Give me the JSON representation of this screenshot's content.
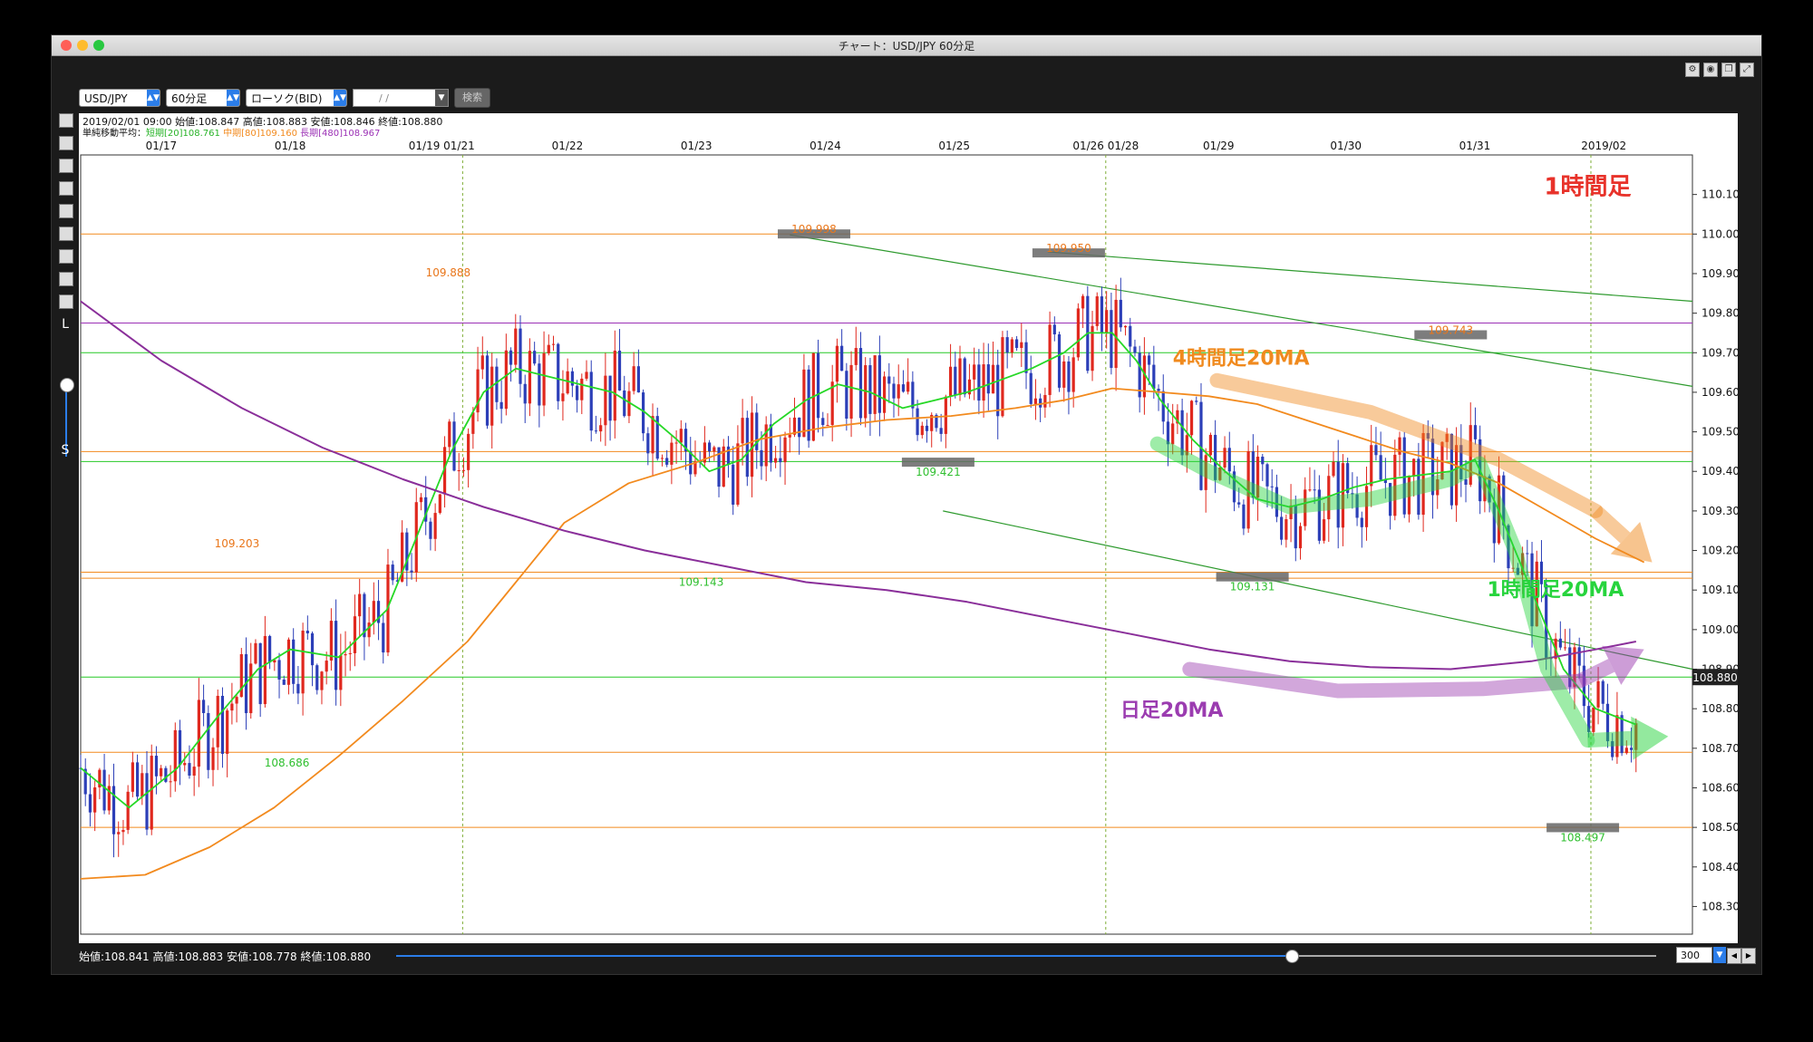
{
  "window": {
    "title": "チャート：USD/JPY 60分足"
  },
  "controls": {
    "pair": "USD/JPY",
    "timeframe": "60分足",
    "chart_type": "ローソク(BID)",
    "date_placeholder": "/ /",
    "search_label": "検索"
  },
  "toolbar_icons": [
    "gear-icon",
    "camera-icon",
    "window-icon",
    "expand-icon"
  ],
  "left_tools": {
    "letter_l": "L",
    "letter_s": "S"
  },
  "info": {
    "line1": "2019/02/01 09:00 始値:108.847 高値:108.883 安値:108.846 終値:108.880",
    "ma_label": "単純移動平均：",
    "ma_short": "短期[20]108.761",
    "ma_mid": "中期[80]109.160",
    "ma_long": "長期[480]108.967"
  },
  "status": {
    "text": "始値:108.841 高値:108.883 安値:108.778 終値:108.880",
    "count": "300",
    "count_fraction": 0.71
  },
  "colors": {
    "candle_up": "#e0281e",
    "candle_down": "#2c3fb8",
    "ma20": "#26d826",
    "ma80": "#f28a1e",
    "ma480": "#8a2f9a",
    "label_red": "#e8322a",
    "label_orange": "#f08a1e",
    "label_purple": "#9b3cb0",
    "label_green": "#27d43d"
  },
  "chart_data": {
    "type": "candlestick",
    "symbol": "USD/JPY",
    "ylim": [
      108.23,
      110.2
    ],
    "y_ticks": [
      "110.100",
      "110.000",
      "109.900",
      "109.800",
      "109.700",
      "109.600",
      "109.500",
      "109.400",
      "109.300",
      "109.200",
      "109.100",
      "109.000",
      "108.900",
      "108.800",
      "108.700",
      "108.600",
      "108.500",
      "108.400",
      "108.300"
    ],
    "x_labels": [
      {
        "t": 0.05,
        "text": "01/17"
      },
      {
        "t": 0.13,
        "text": "01/18"
      },
      {
        "t": 0.224,
        "text": "01/19 01/21"
      },
      {
        "t": 0.302,
        "text": "01/22"
      },
      {
        "t": 0.382,
        "text": "01/23"
      },
      {
        "t": 0.462,
        "text": "01/24"
      },
      {
        "t": 0.542,
        "text": "01/25"
      },
      {
        "t": 0.636,
        "text": "01/26 01/28"
      },
      {
        "t": 0.706,
        "text": "01/29"
      },
      {
        "t": 0.785,
        "text": "01/30"
      },
      {
        "t": 0.865,
        "text": "01/31"
      },
      {
        "t": 0.945,
        "text": "2019/02"
      }
    ],
    "week_markers": [
      0.237,
      0.636,
      0.937
    ],
    "last_price": "108.880",
    "hlines": [
      {
        "y": 110.0,
        "color": "orange"
      },
      {
        "y": 109.775,
        "color": "purple"
      },
      {
        "y": 109.7,
        "color": "green"
      },
      {
        "y": 109.45,
        "color": "orange"
      },
      {
        "y": 109.425,
        "color": "green"
      },
      {
        "y": 109.145,
        "color": "orange"
      },
      {
        "y": 109.13,
        "color": "orange"
      },
      {
        "y": 108.88,
        "color": "green"
      },
      {
        "y": 108.69,
        "color": "orange"
      },
      {
        "y": 108.5,
        "color": "orange"
      }
    ],
    "price_labels": [
      {
        "t": 0.455,
        "y": 109.998,
        "text": "109.998",
        "color": "orange",
        "pos": "above",
        "box": true
      },
      {
        "t": 0.613,
        "y": 109.95,
        "text": "109.950",
        "color": "orange",
        "pos": "above",
        "box": true
      },
      {
        "t": 0.228,
        "y": 109.888,
        "text": "109.888",
        "color": "orange",
        "pos": "above",
        "box": false
      },
      {
        "t": 0.85,
        "y": 109.743,
        "text": "109.743",
        "color": "orange",
        "pos": "above",
        "box": true
      },
      {
        "t": 0.097,
        "y": 109.203,
        "text": "109.203",
        "color": "orange",
        "pos": "above",
        "box": false
      },
      {
        "t": 0.532,
        "y": 109.421,
        "text": "109.421",
        "color": "green",
        "pos": "below",
        "box": true
      },
      {
        "t": 0.385,
        "y": 109.143,
        "text": "109.143",
        "color": "green",
        "pos": "below",
        "box": false
      },
      {
        "t": 0.727,
        "y": 109.131,
        "text": "109.131",
        "color": "green",
        "pos": "below",
        "box": true
      },
      {
        "t": 0.128,
        "y": 108.686,
        "text": "108.686",
        "color": "green",
        "pos": "below",
        "box": false
      },
      {
        "t": 0.932,
        "y": 108.497,
        "text": "108.497",
        "color": "green",
        "pos": "below",
        "box": true
      }
    ],
    "trendlines": [
      {
        "t1": 0.44,
        "y1": 109.998,
        "t2": 1.0,
        "y2": 109.615
      },
      {
        "t1": 0.6,
        "y1": 109.955,
        "t2": 1.0,
        "y2": 109.83
      },
      {
        "t1": 0.535,
        "y1": 109.3,
        "t2": 1.0,
        "y2": 108.9
      }
    ],
    "series": [
      {
        "name": "短期[20]",
        "color": "ma20",
        "points": [
          [
            0.0,
            108.65
          ],
          [
            0.03,
            108.55
          ],
          [
            0.06,
            108.65
          ],
          [
            0.085,
            108.78
          ],
          [
            0.11,
            108.9
          ],
          [
            0.13,
            108.95
          ],
          [
            0.16,
            108.93
          ],
          [
            0.19,
            109.05
          ],
          [
            0.21,
            109.25
          ],
          [
            0.23,
            109.45
          ],
          [
            0.25,
            109.6
          ],
          [
            0.27,
            109.66
          ],
          [
            0.29,
            109.64
          ],
          [
            0.31,
            109.62
          ],
          [
            0.33,
            109.6
          ],
          [
            0.35,
            109.55
          ],
          [
            0.37,
            109.48
          ],
          [
            0.39,
            109.4
          ],
          [
            0.41,
            109.43
          ],
          [
            0.43,
            109.52
          ],
          [
            0.45,
            109.58
          ],
          [
            0.47,
            109.62
          ],
          [
            0.49,
            109.6
          ],
          [
            0.51,
            109.56
          ],
          [
            0.53,
            109.58
          ],
          [
            0.55,
            109.6
          ],
          [
            0.57,
            109.63
          ],
          [
            0.59,
            109.66
          ],
          [
            0.61,
            109.7
          ],
          [
            0.625,
            109.75
          ],
          [
            0.64,
            109.75
          ],
          [
            0.655,
            109.68
          ],
          [
            0.67,
            109.58
          ],
          [
            0.69,
            109.48
          ],
          [
            0.71,
            109.4
          ],
          [
            0.73,
            109.33
          ],
          [
            0.75,
            109.31
          ],
          [
            0.77,
            109.33
          ],
          [
            0.79,
            109.36
          ],
          [
            0.81,
            109.38
          ],
          [
            0.83,
            109.39
          ],
          [
            0.85,
            109.4
          ],
          [
            0.865,
            109.43
          ],
          [
            0.88,
            109.3
          ],
          [
            0.9,
            109.1
          ],
          [
            0.92,
            108.9
          ],
          [
            0.94,
            108.8
          ],
          [
            0.965,
            108.76
          ]
        ]
      },
      {
        "name": "中期[80]",
        "color": "ma80",
        "points": [
          [
            0.0,
            108.37
          ],
          [
            0.04,
            108.38
          ],
          [
            0.08,
            108.45
          ],
          [
            0.12,
            108.55
          ],
          [
            0.16,
            108.68
          ],
          [
            0.2,
            108.82
          ],
          [
            0.24,
            108.97
          ],
          [
            0.27,
            109.12
          ],
          [
            0.3,
            109.27
          ],
          [
            0.34,
            109.37
          ],
          [
            0.38,
            109.42
          ],
          [
            0.42,
            109.48
          ],
          [
            0.46,
            109.51
          ],
          [
            0.5,
            109.53
          ],
          [
            0.54,
            109.54
          ],
          [
            0.58,
            109.56
          ],
          [
            0.61,
            109.58
          ],
          [
            0.64,
            109.61
          ],
          [
            0.67,
            109.6
          ],
          [
            0.7,
            109.59
          ],
          [
            0.73,
            109.57
          ],
          [
            0.76,
            109.53
          ],
          [
            0.79,
            109.49
          ],
          [
            0.82,
            109.45
          ],
          [
            0.85,
            109.42
          ],
          [
            0.88,
            109.37
          ],
          [
            0.91,
            109.3
          ],
          [
            0.94,
            109.23
          ],
          [
            0.97,
            109.17
          ]
        ]
      },
      {
        "name": "長期[480]",
        "color": "ma480",
        "points": [
          [
            0.0,
            109.83
          ],
          [
            0.05,
            109.68
          ],
          [
            0.1,
            109.56
          ],
          [
            0.15,
            109.46
          ],
          [
            0.2,
            109.38
          ],
          [
            0.25,
            109.31
          ],
          [
            0.3,
            109.25
          ],
          [
            0.35,
            109.2
          ],
          [
            0.4,
            109.16
          ],
          [
            0.45,
            109.12
          ],
          [
            0.5,
            109.1
          ],
          [
            0.55,
            109.07
          ],
          [
            0.6,
            109.03
          ],
          [
            0.65,
            108.99
          ],
          [
            0.7,
            108.95
          ],
          [
            0.75,
            108.92
          ],
          [
            0.8,
            108.905
          ],
          [
            0.85,
            108.9
          ],
          [
            0.9,
            108.92
          ],
          [
            0.94,
            108.95
          ],
          [
            0.965,
            108.97
          ]
        ]
      }
    ],
    "annotations": [
      {
        "text": "1時間足",
        "t": 0.935,
        "y": 110.1,
        "color": "label_red",
        "size": 26
      },
      {
        "text": "4時間足20MA",
        "t": 0.72,
        "y": 109.67,
        "color": "label_orange",
        "size": 22
      },
      {
        "text": "1時間足20MA",
        "t": 0.915,
        "y": 109.085,
        "color": "label_green",
        "size": 22
      },
      {
        "text": "日足20MA",
        "t": 0.677,
        "y": 108.78,
        "color": "label_purple",
        "size": 22
      }
    ],
    "arrows": [
      {
        "color": "label_orange",
        "points": [
          [
            0.705,
            109.63
          ],
          [
            0.8,
            109.55
          ],
          [
            0.88,
            109.43
          ],
          [
            0.94,
            109.3
          ]
        ],
        "head": [
          0.975,
          109.17
        ]
      },
      {
        "color": "label_purple",
        "points": [
          [
            0.688,
            108.9
          ],
          [
            0.78,
            108.845
          ],
          [
            0.87,
            108.85
          ],
          [
            0.93,
            108.87
          ]
        ],
        "head": [
          0.97,
          108.95
        ]
      },
      {
        "color": "label_green",
        "points": [
          [
            0.668,
            109.47
          ],
          [
            0.7,
            109.4
          ],
          [
            0.75,
            109.31
          ],
          [
            0.8,
            109.33
          ],
          [
            0.85,
            109.38
          ],
          [
            0.868,
            109.42
          ],
          [
            0.89,
            109.2
          ],
          [
            0.91,
            108.9
          ],
          [
            0.935,
            108.72
          ]
        ],
        "head": [
          0.985,
          108.73
        ]
      }
    ]
  }
}
